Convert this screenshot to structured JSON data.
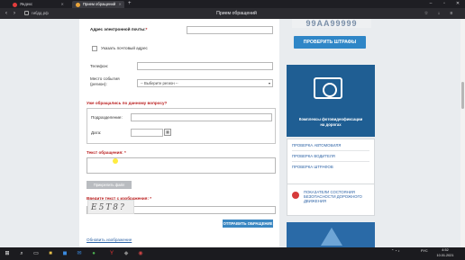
{
  "browser": {
    "tabs": [
      {
        "label": "Яндекс"
      },
      {
        "label": "Прием обращений"
      }
    ],
    "url": "гибдд.рф",
    "page_title": "Прием обращений"
  },
  "form": {
    "email_label": "Адрес электронной почты:",
    "email_required": "*",
    "postal_checkbox_label": "Указать почтовый адрес",
    "phone_label": "Телефон:",
    "region_label": "Место события\n(регион):",
    "region_value": "-- Выберите регион --",
    "prior_question": "Уже обращались по данному вопросу?",
    "unit_label": "Подразделение:",
    "date_label": "Дата:",
    "message_label": "Текст обращения:",
    "message_required": "*",
    "attach_button": "Прикрепить файл",
    "captcha_label": "Введите текст с изображения:",
    "captcha_required": "*",
    "captcha_text": "Е5Т8?",
    "submit_button": "ОТПРАВИТЬ ОБРАЩЕНИЕ",
    "refresh_link": "Обновить изображение"
  },
  "sidebar": {
    "plate_text": "99АА99999",
    "check_fines_button": "ПРОВЕРИТЬ ШТРАФЫ",
    "banner_text": "Комплексы фотовидеофиксации\nна дорогах",
    "links": [
      {
        "label": "ПРОВЕРКА АВТОМОБИЛЯ"
      },
      {
        "label": "ПРОВЕРКА ВОДИТЕЛЯ"
      },
      {
        "label": "ПРОВЕРКА ШТРАФОВ"
      }
    ],
    "stats_text": "ПОКАЗАТЕЛИ СОСТОЯНИЯ БЕЗОПАСНОСТИ ДОРОЖНОГО ДВИЖЕНИЯ"
  },
  "taskbar": {
    "language": "РУС",
    "time": "4:52",
    "date": "10.01.2021"
  }
}
